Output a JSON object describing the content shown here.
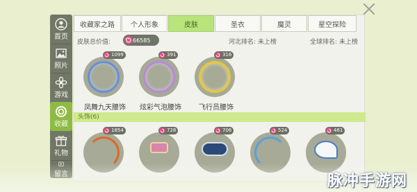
{
  "sidebar": {
    "items": [
      {
        "label": "首页",
        "icon": "user-icon"
      },
      {
        "label": "照片",
        "icon": "photo-icon"
      },
      {
        "label": "游戏",
        "icon": "flower-icon"
      },
      {
        "label": "收藏",
        "icon": "ring-icon",
        "active": true
      },
      {
        "label": "礼物",
        "icon": "gift-icon"
      },
      {
        "label": "留言",
        "icon": "message-icon"
      }
    ]
  },
  "tabs": [
    {
      "label": "收藏家之路"
    },
    {
      "label": "个人形象"
    },
    {
      "label": "皮肤",
      "active": true
    },
    {
      "label": "圣衣"
    },
    {
      "label": "魔灵"
    },
    {
      "label": "星空探险"
    }
  ],
  "stats": {
    "total_label": "皮肤总价值:",
    "total_value": "66585",
    "rank_region": "河北排名: 未上榜",
    "rank_global": "全球排名: 未上榜"
  },
  "row1": [
    {
      "value": "1099",
      "name": "凤舞九天腰饰",
      "color": "#6a8fd6"
    },
    {
      "value": "391",
      "name": "炫彩气泡腰饰",
      "color": "#b98ad8"
    },
    {
      "value": "316",
      "name": "飞行员腰饰",
      "color": "#e6c83a"
    }
  ],
  "section": {
    "label": "头饰(6)"
  },
  "row2": [
    {
      "value": "1854",
      "color": "#e0662a"
    },
    {
      "value": "728",
      "color": "#d887a8"
    },
    {
      "value": "706",
      "color": "#2c4a78"
    },
    {
      "value": "524",
      "color": "#5aa0d8"
    },
    {
      "value": "461",
      "color": "#4a7cc4"
    }
  ],
  "watermark": "脉冲手游网",
  "colors": {
    "accent": "#b8e47c",
    "sidebar": "#707766",
    "active_side": "#8dbb43"
  }
}
